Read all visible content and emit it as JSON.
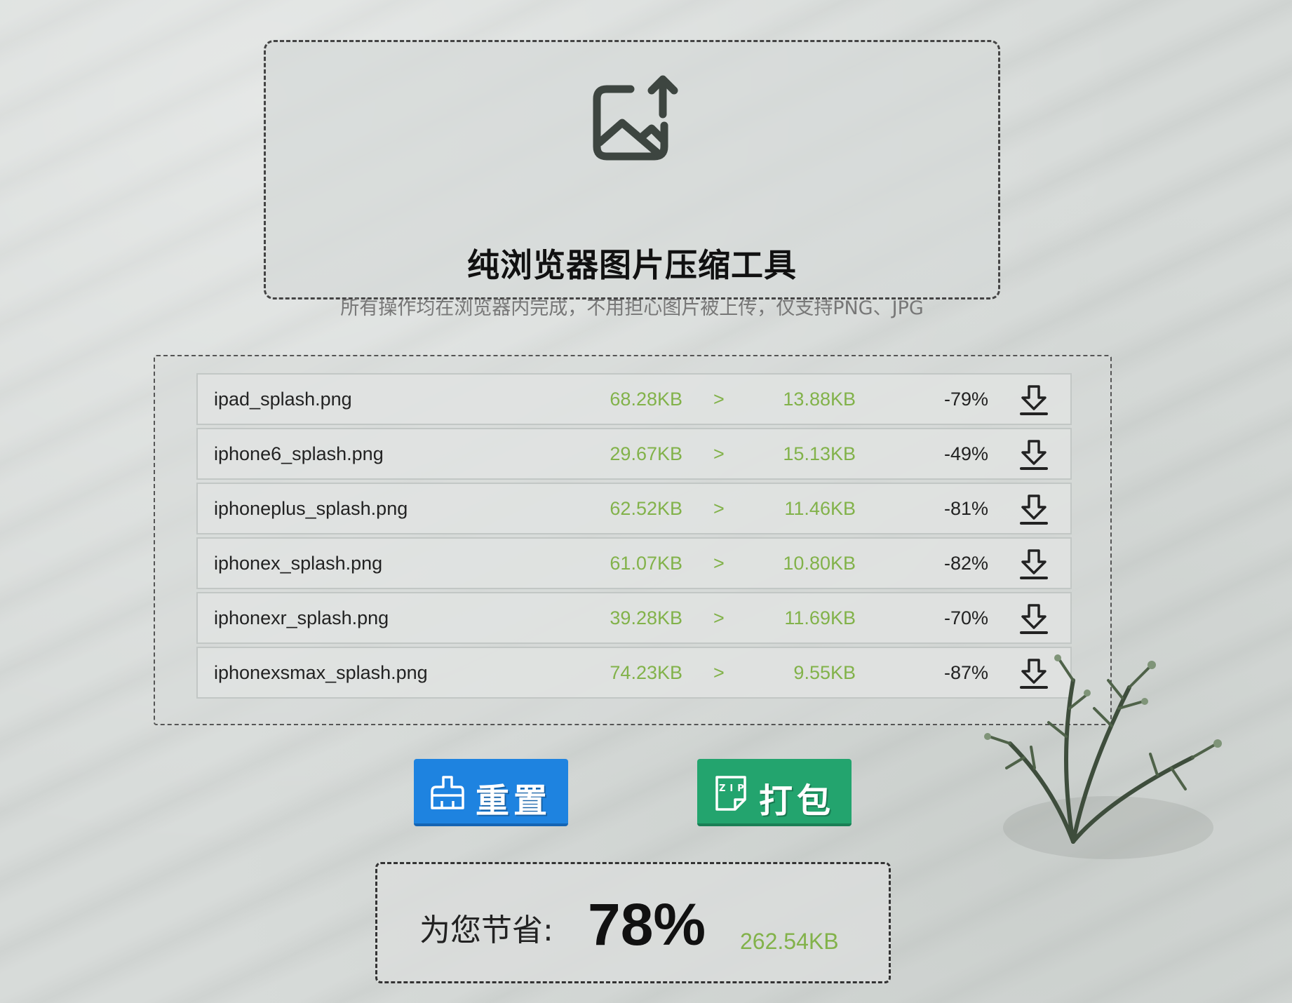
{
  "upload": {
    "icon": "image-upload-icon",
    "title": "纯浏览器图片压缩工具",
    "subtitle": "所有操作均在浏览器内完成，不用担心图片被上传，仅支持PNG、JPG"
  },
  "files": [
    {
      "name": "ipad_splash.png",
      "original_size": "68.28KB",
      "arrow": ">",
      "compressed_size": "13.88KB",
      "ratio": "-79%"
    },
    {
      "name": "iphone6_splash.png",
      "original_size": "29.67KB",
      "arrow": ">",
      "compressed_size": "15.13KB",
      "ratio": "-49%"
    },
    {
      "name": "iphoneplus_splash.png",
      "original_size": "62.52KB",
      "arrow": ">",
      "compressed_size": "11.46KB",
      "ratio": "-81%"
    },
    {
      "name": "iphonex_splash.png",
      "original_size": "61.07KB",
      "arrow": ">",
      "compressed_size": "10.80KB",
      "ratio": "-82%"
    },
    {
      "name": "iphonexr_splash.png",
      "original_size": "39.28KB",
      "arrow": ">",
      "compressed_size": "11.69KB",
      "ratio": "-70%"
    },
    {
      "name": "iphonexsmax_splash.png",
      "original_size": "74.23KB",
      "arrow": ">",
      "compressed_size": "9.55KB",
      "ratio": "-87%"
    }
  ],
  "actions": {
    "reset_label": "重置",
    "reset_icon": "broom-icon",
    "pack_label": "打包",
    "pack_icon": "zip-file-icon"
  },
  "savings": {
    "label": "为您节省:",
    "percent": "78%",
    "amount": "262.54KB"
  },
  "colors": {
    "accent_green": "#82b24a",
    "reset_blue": "#1e83e0",
    "pack_green": "#23a46e"
  }
}
